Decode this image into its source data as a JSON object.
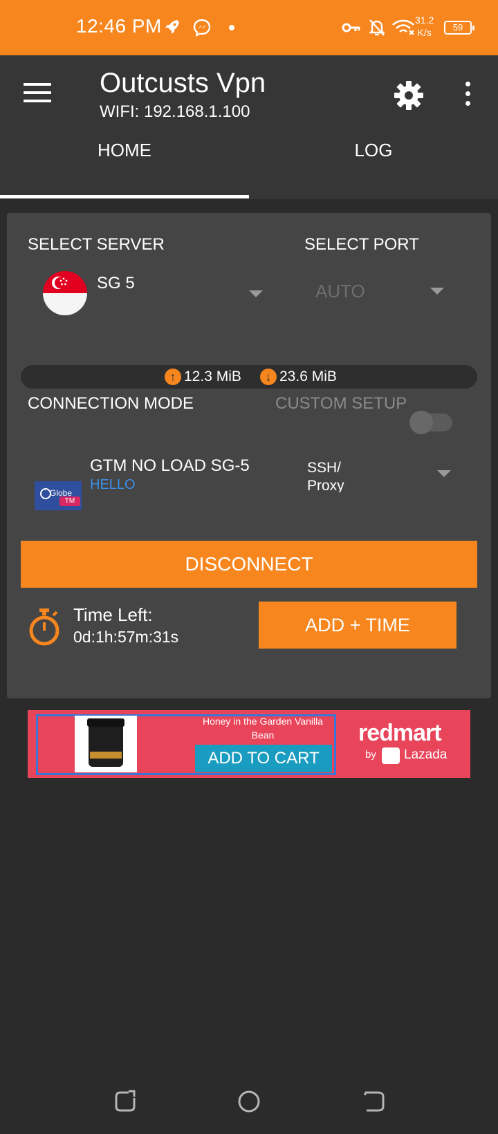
{
  "status_bar": {
    "time": "12:46 PM",
    "net_speed_value": "31.2",
    "net_speed_unit": "K/s",
    "battery": "59",
    "icons": [
      "rocket-icon",
      "messenger-icon",
      "dot-icon",
      "vpn-key-icon",
      "bell-off-icon",
      "wifi-icon",
      "battery-icon"
    ]
  },
  "app_bar": {
    "title": "Outcusts Vpn",
    "subtitle": "WIFI: 192.168.1.100",
    "tabs": [
      {
        "label": "HOME",
        "active": true
      },
      {
        "label": "LOG",
        "active": false
      }
    ]
  },
  "server": {
    "select_server_label": "SELECT SERVER",
    "select_port_label": "SELECT PORT",
    "server_name": "SG 5",
    "port_value": "AUTO"
  },
  "traffic": {
    "upload": "12.3 MiB",
    "download": "23.6 MiB"
  },
  "connection": {
    "mode_label": "CONNECTION MODE",
    "custom_setup_label": "CUSTOM SETUP",
    "custom_setup_enabled": false,
    "network_name": "GTM NO LOAD SG-5",
    "network_sub": "HELLO",
    "protocol": "SSH/ Proxy"
  },
  "actions": {
    "disconnect": "DISCONNECT",
    "time_left_label": "Time Left:",
    "time_left_value": "0d:1h:57m:31s",
    "add_time": "ADD + TIME"
  },
  "ad": {
    "product_title": "Honey in the Garden Vanilla Bean",
    "cta": "ADD TO CART",
    "brand": "redmart",
    "by": "by",
    "partner": "Lazada"
  },
  "colors": {
    "accent": "#f7861e",
    "background": "#2b2b2b",
    "card": "#454545",
    "link": "#3d8fe8"
  }
}
